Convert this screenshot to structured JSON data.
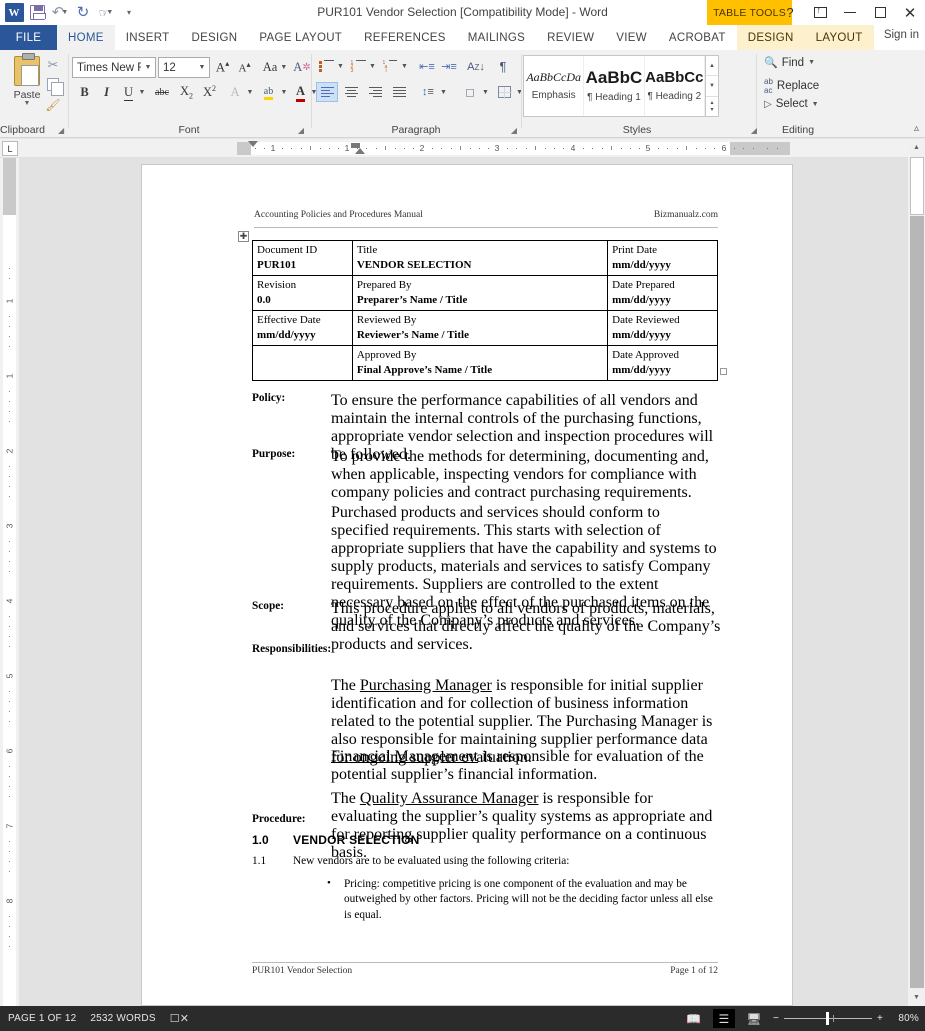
{
  "titlebar": {
    "app_icon": "word-logo",
    "quick_access": [
      {
        "name": "save-icon",
        "label": "Save"
      },
      {
        "name": "undo-icon",
        "label": "Undo"
      },
      {
        "name": "redo-icon",
        "label": "Redo"
      },
      {
        "name": "touch-mode-icon",
        "label": "Touch/Mouse Mode"
      },
      {
        "name": "customize-qat-icon",
        "label": "Customize Quick Access Toolbar"
      }
    ],
    "title": "PUR101 Vendor Selection [Compatibility Mode] - Word",
    "context_tab_group": "TABLE TOOLS",
    "help_label": "?",
    "ribbon_display_label": "Ribbon Display Options",
    "minimize_label": "Minimize",
    "restore_label": "Restore Down",
    "close_label": "Close"
  },
  "tabs": {
    "file": "FILE",
    "items": [
      {
        "label": "HOME",
        "active": true
      },
      {
        "label": "INSERT",
        "active": false
      },
      {
        "label": "DESIGN",
        "active": false
      },
      {
        "label": "PAGE LAYOUT",
        "active": false
      },
      {
        "label": "REFERENCES",
        "active": false
      },
      {
        "label": "MAILINGS",
        "active": false
      },
      {
        "label": "REVIEW",
        "active": false
      },
      {
        "label": "VIEW",
        "active": false
      },
      {
        "label": "ACROBAT",
        "active": false
      }
    ],
    "context_items": [
      {
        "label": "DESIGN"
      },
      {
        "label": "LAYOUT"
      }
    ],
    "signin": "Sign in"
  },
  "ribbon": {
    "groups": [
      {
        "name": "clipboard",
        "label": "Clipboard"
      },
      {
        "name": "font",
        "label": "Font"
      },
      {
        "name": "paragraph",
        "label": "Paragraph"
      },
      {
        "name": "styles",
        "label": "Styles"
      },
      {
        "name": "editing",
        "label": "Editing"
      }
    ],
    "clipboard": {
      "paste_label": "Paste",
      "cut_label": "Cut",
      "copy_label": "Copy",
      "format_painter_label": "Format Painter"
    },
    "font": {
      "font_name": "Times New Rе",
      "font_name_full": "Times New Roman",
      "font_size": "12",
      "grow_label": "A",
      "shrink_label": "A",
      "change_case_label": "Aa",
      "clear_formatting_label": "Clear All Formatting",
      "bold_label": "B",
      "italic_label": "I",
      "underline_label": "U",
      "strike_label": "abc",
      "subscript_label": "X",
      "superscript_label": "X",
      "text_effects_label": "A",
      "highlight_label": "ab",
      "font_color_label": "A",
      "highlight_color": "#ffd400",
      "font_color": "#c00000"
    },
    "paragraph": {
      "bullets_label": "Bullets",
      "numbering_label": "Numbering",
      "multilevel_label": "Multilevel List",
      "decrease_indent_label": "Decrease Indent",
      "increase_indent_label": "Increase Indent",
      "sort_label": "Sort",
      "show_marks_label": "¶",
      "align_left_label": "Align Left",
      "align_center_label": "Center",
      "align_right_label": "Align Right",
      "justify_label": "Justify",
      "line_spacing_label": "Line and Paragraph Spacing",
      "shading_label": "Shading",
      "borders_label": "Borders"
    },
    "styles": {
      "items": [
        {
          "preview": "AaBbCcDa",
          "name": "Emphasis",
          "style": "emphasis"
        },
        {
          "preview": "AaBbC",
          "name": "¶ Heading 1",
          "style": "heading1"
        },
        {
          "preview": "AaBbCc",
          "name": "¶ Heading 2",
          "style": "heading2"
        }
      ]
    },
    "editing": {
      "find_label": "Find",
      "replace_label": "Replace",
      "select_label": "Select"
    },
    "collapse_label": "Collapse the Ribbon"
  },
  "rulers": {
    "corner_label": "L",
    "h_numbers": [
      "1",
      "1",
      "2",
      "3",
      "4",
      "5",
      "6"
    ],
    "v_numbers": [
      "1",
      "1",
      "2",
      "3",
      "4",
      "5",
      "6",
      "7",
      "8"
    ]
  },
  "document": {
    "header": {
      "left": "Accounting Policies and Procedures Manual",
      "right": "Bizmanualz.com"
    },
    "table": {
      "rows": [
        [
          {
            "label": "Document ID",
            "value": "PUR101"
          },
          {
            "label": "Title",
            "value": "VENDOR SELECTION"
          },
          {
            "label": "Print Date",
            "value": "mm/dd/yyyy"
          }
        ],
        [
          {
            "label": "Revision",
            "value": "0.0"
          },
          {
            "label": "Prepared By",
            "value": "Preparer’s Name / Title"
          },
          {
            "label": "Date Prepared",
            "value": "mm/dd/yyyy"
          }
        ],
        [
          {
            "label": "Effective Date",
            "value": "mm/dd/yyyy"
          },
          {
            "label": "Reviewed By",
            "value": "Reviewer’s Name / Title"
          },
          {
            "label": "Date Reviewed",
            "value": "mm/dd/yyyy"
          }
        ],
        [
          {
            "label": "",
            "value": ""
          },
          {
            "label": "Approved By",
            "value": "Final Approve’s Name / Title"
          },
          {
            "label": "Date Approved",
            "value": "mm/dd/yyyy"
          }
        ]
      ]
    },
    "sections": {
      "policy_label": "Policy:",
      "policy_text": "To ensure the performance capabilities of all vendors and maintain the internal controls of the purchasing functions, appropriate vendor selection and inspection procedures will be followed.",
      "purpose_label": "Purpose:",
      "purpose_text_1": "To provide the methods for determining, documenting and, when applicable, inspecting vendors for compliance with company policies and contract purchasing requirements.",
      "purpose_text_2": "Purchased products and services should conform to specified requirements.  This starts with selection of appropriate suppliers that have the capability and systems to supply products, materials and services to satisfy Company requirements.  Suppliers are controlled to the extent necessary based on the effect of the purchased items on the quality of the Company’s products and services.",
      "scope_label": "Scope:",
      "scope_text": "This procedure applies to all vendors of products, materials, and services that directly affect the quality of the Company’s products and services.",
      "responsibilities_label": "Responsibilities:",
      "resp_1_pre": "The ",
      "resp_1_link": "Purchasing Manager",
      "resp_1_post": " is responsible for initial supplier identification and for collection of business information related to the potential supplier.  The Purchasing Manager is also responsible for maintaining supplier performance data for ongoing suppler evaluation.",
      "resp_2_link": "Financial Management",
      "resp_2_post": " is responsible for evaluation of the potential supplier’s financial information.",
      "resp_3_pre": "The ",
      "resp_3_link": "Quality Assurance Manager",
      "resp_3_post": " is responsible for evaluating the supplier’s quality systems as appropriate and for reporting supplier quality performance on a continuous basis."
    },
    "procedure": {
      "label": "Procedure:",
      "h1_num": "1.0",
      "h1_title": "VENDOR SELECTION",
      "item_num": "1.1",
      "item_text": "New vendors are to be evaluated using the following criteria:",
      "bullet_marker": "•",
      "bullet_text": "Pricing: competitive pricing is one component of the evaluation and may be outweighed by other factors.  Pricing will not be the deciding factor unless all else is equal."
    },
    "footer": {
      "left": "PUR101 Vendor Selection",
      "right": "Page 1 of 12"
    }
  },
  "statusbar": {
    "page_info": "PAGE 1 OF 12",
    "word_count": "2532 WORDS",
    "proofing_label": "Proofing errors",
    "views": [
      {
        "name": "read-mode-icon",
        "label": "Read Mode",
        "selected": false
      },
      {
        "name": "print-layout-icon",
        "label": "Print Layout",
        "selected": true
      },
      {
        "name": "web-layout-icon",
        "label": "Web Layout",
        "selected": false
      }
    ],
    "zoom_out_label": "−",
    "zoom_in_label": "+",
    "zoom_level": "80%"
  }
}
